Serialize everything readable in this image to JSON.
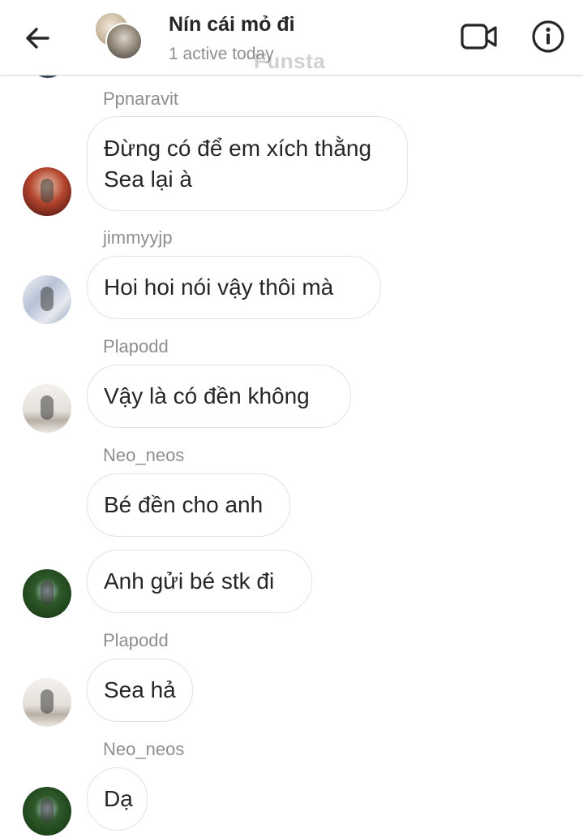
{
  "header": {
    "title": "Nín cái mỏ đi",
    "status": "1 active today",
    "watermark": "Funsta"
  },
  "icons": {
    "back": "arrow-left-icon",
    "video": "video-camera-icon",
    "info": "info-circle-icon"
  },
  "messages": [
    {
      "sender": "Ppnaravit",
      "text": "Đừng có để em xích thằng Sea lại à"
    },
    {
      "sender": "jimmyyjp",
      "text": "Hoi hoi nói vậy thôi mà"
    },
    {
      "sender": "Plapodd",
      "text": "Vậy là có đền không"
    },
    {
      "sender": "Neo_neos",
      "text": "Bé đền cho anh"
    },
    {
      "sender": "",
      "text": "Anh gửi bé stk đi"
    },
    {
      "sender": "Plapodd",
      "text": "Sea hả"
    },
    {
      "sender": "Neo_neos",
      "text": "Dạ"
    }
  ],
  "colors": {
    "text": "#262626",
    "muted": "#8e8e8e",
    "bubble_border": "#e2e2e2",
    "background": "#ffffff"
  }
}
